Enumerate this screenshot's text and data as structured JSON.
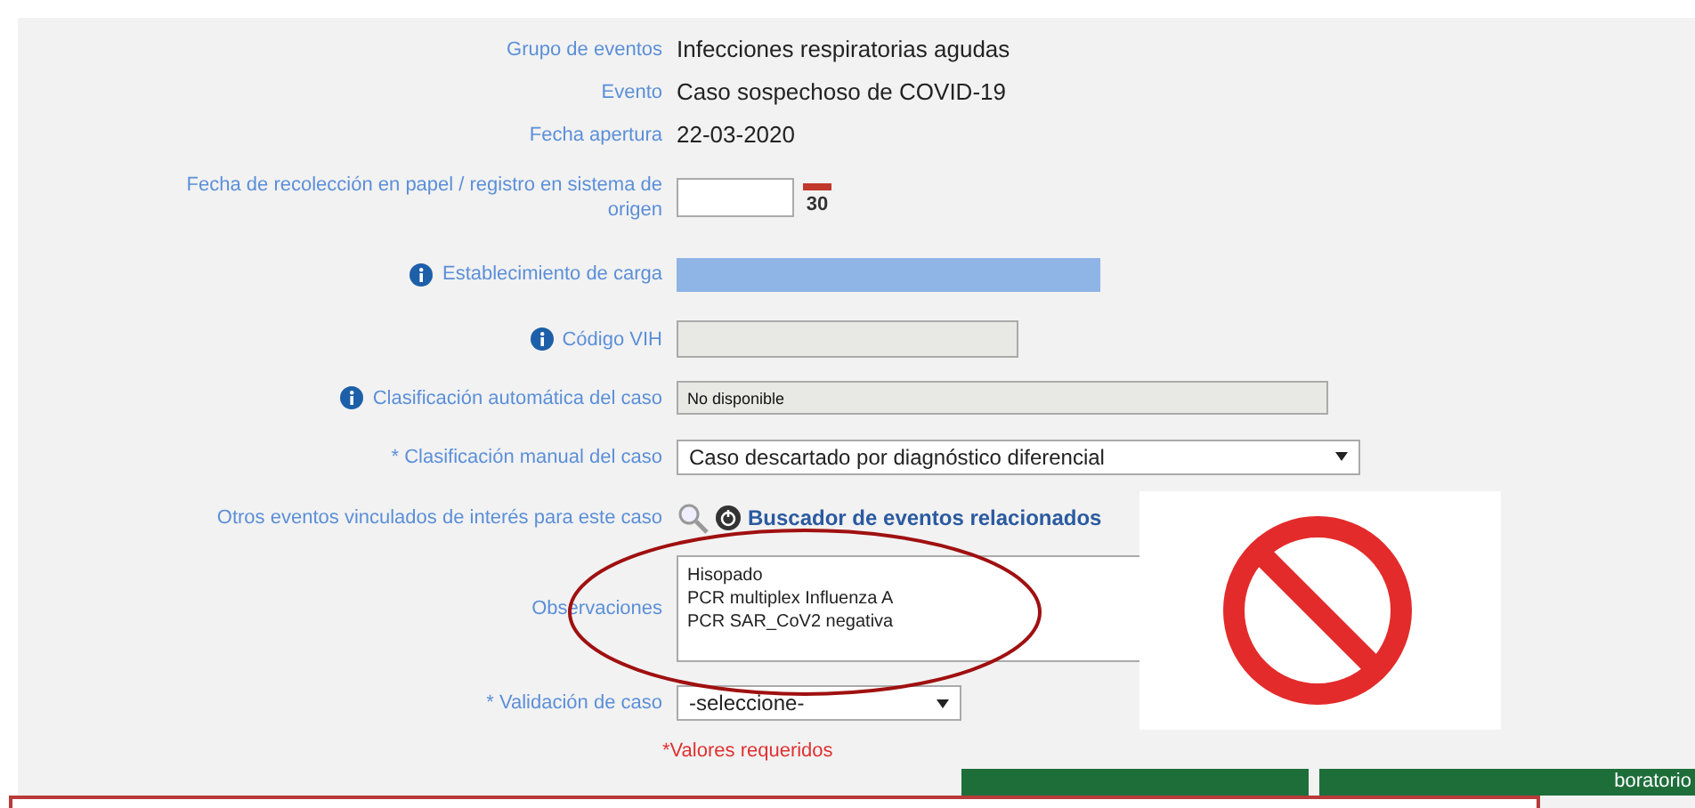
{
  "fields": [
    {
      "kind": "text",
      "label": "Grupo de eventos",
      "value": "Infecciones respiratorias agudas",
      "info": false
    },
    {
      "kind": "text",
      "label": "Evento",
      "value": "Caso sospechoso de COVID-19",
      "info": false
    },
    {
      "kind": "text",
      "label": "Fecha apertura",
      "value": "22-03-2020",
      "info": false
    },
    {
      "kind": "date",
      "label": "Fecha de recolección en papel / registro en sistema de origen",
      "calendar_day": "30",
      "info": false
    },
    {
      "kind": "highlight",
      "label": "Establecimiento de carga",
      "info": true
    },
    {
      "kind": "readonly",
      "label": "Código VIH",
      "info": true
    },
    {
      "kind": "readonly-wide",
      "label": "Clasificación automática del caso",
      "value": "No disponible",
      "info": true
    },
    {
      "kind": "select-wide",
      "label": "* Clasificación manual del caso",
      "value": "Caso descartado por diagnóstico diferencial",
      "info": false
    },
    {
      "kind": "link",
      "label": "Otros eventos vinculados de interés para este caso",
      "value": "Buscador de eventos relacionados",
      "info": false
    },
    {
      "kind": "textarea",
      "label": "Observaciones",
      "lines": [
        "Hisopado",
        "PCR multiplex Influenza A",
        "PCR SAR_CoV2 negativa"
      ],
      "info": false
    },
    {
      "kind": "select",
      "label": "* Validación de caso",
      "value": "-seleccione-",
      "info": false
    }
  ],
  "required_note": "*Valores requeridos",
  "buttons": [
    {
      "kind": "covered"
    },
    {
      "kind": "labelled",
      "label": "boratorio"
    }
  ]
}
